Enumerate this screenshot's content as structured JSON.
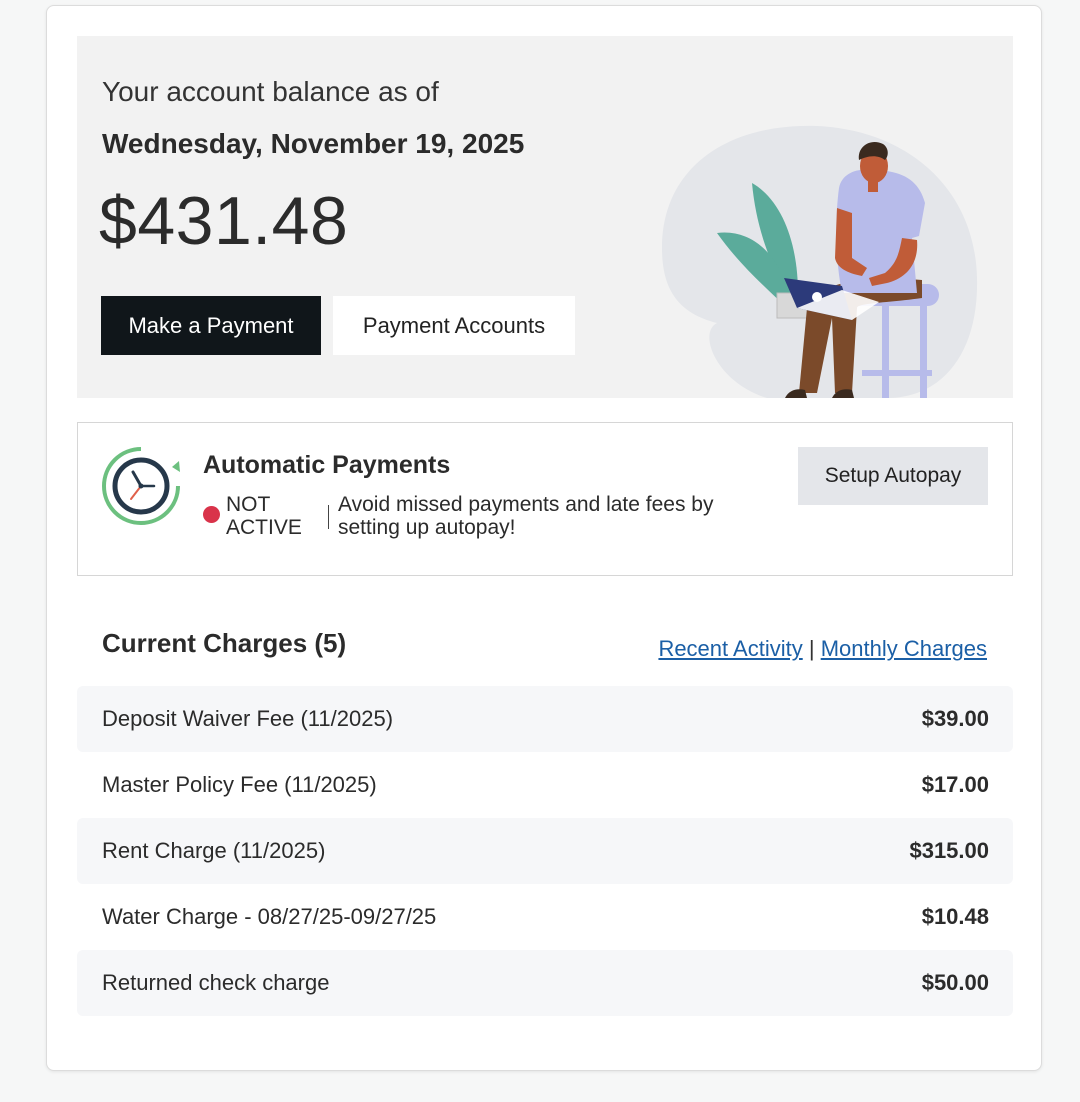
{
  "balance": {
    "intro": "Your account balance as of",
    "date": "Wednesday, November 19, 2025",
    "amount": "$431.48",
    "make_payment_label": "Make a Payment",
    "payment_accounts_label": "Payment Accounts"
  },
  "autopay": {
    "title": "Automatic Payments",
    "status": "NOT ACTIVE",
    "status_color": "#d9334a",
    "message": "Avoid missed payments and late fees by setting up autopay!",
    "button_label": "Setup Autopay"
  },
  "charges": {
    "title": "Current Charges (5)",
    "links": {
      "recent_activity": "Recent Activity",
      "separator": "|",
      "monthly_charges": "Monthly Charges"
    },
    "items": [
      {
        "label": "Deposit Waiver Fee (11/2025)",
        "amount": "$39.00"
      },
      {
        "label": "Master Policy Fee (11/2025)",
        "amount": "$17.00"
      },
      {
        "label": "Rent Charge (11/2025)",
        "amount": "$315.00"
      },
      {
        "label": "Water Charge - 08/27/25-09/27/25",
        "amount": "$10.48"
      },
      {
        "label": "Returned check charge",
        "amount": "$50.00"
      }
    ]
  },
  "colors": {
    "primary_button": "#10161a",
    "link": "#1b5fa6",
    "panel_background": "#f2f2f2"
  }
}
